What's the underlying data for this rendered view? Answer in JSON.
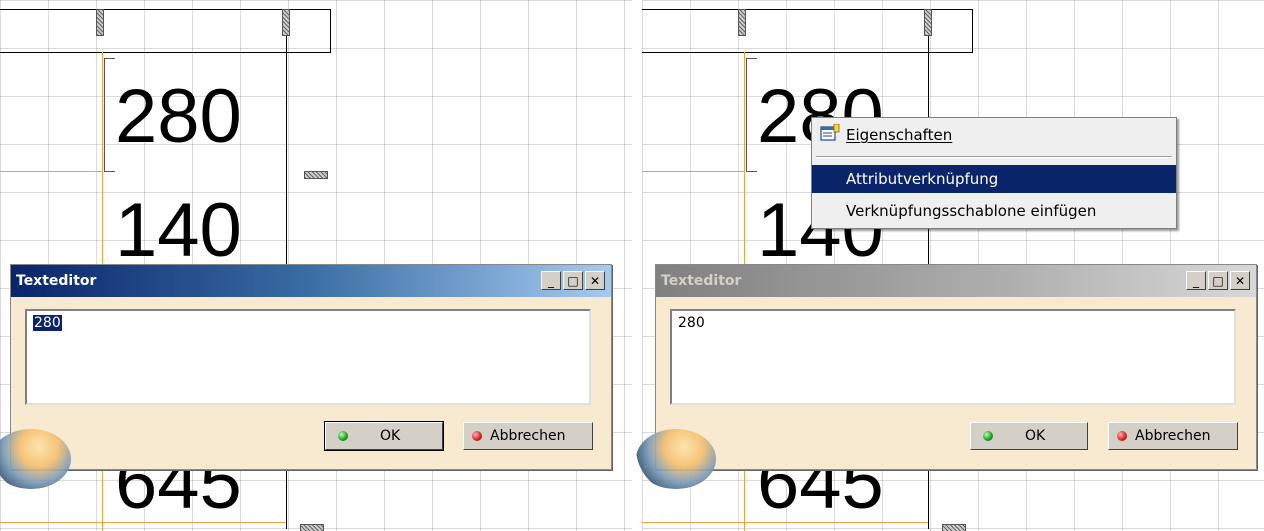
{
  "left_panel": {
    "numbers": [
      "280",
      "140",
      "645"
    ],
    "dialog": {
      "title": "Texteditor",
      "text_value": "280",
      "ok_label": "OK",
      "cancel_label": "Abbrechen"
    }
  },
  "right_panel": {
    "numbers": [
      "280",
      "140",
      "645"
    ],
    "context_menu": {
      "items": [
        "Eigenschaften",
        "Attributverknüpfung",
        "Verknüpfungsschablone einfügen"
      ],
      "highlighted": "Attributverknüpfung"
    },
    "dialog": {
      "title": "Texteditor",
      "text_value": "280",
      "ok_label": "OK",
      "cancel_label": "Abbrechen"
    }
  },
  "window_buttons": {
    "minimize": "_",
    "maximize": "□",
    "close": "✕"
  },
  "colors": {
    "active_title": "#0a246a",
    "inactive_title": "#808080",
    "dialog_bg": "#f7ead0",
    "highlight": "#0a246a",
    "orange_line": "#f0a03c"
  }
}
